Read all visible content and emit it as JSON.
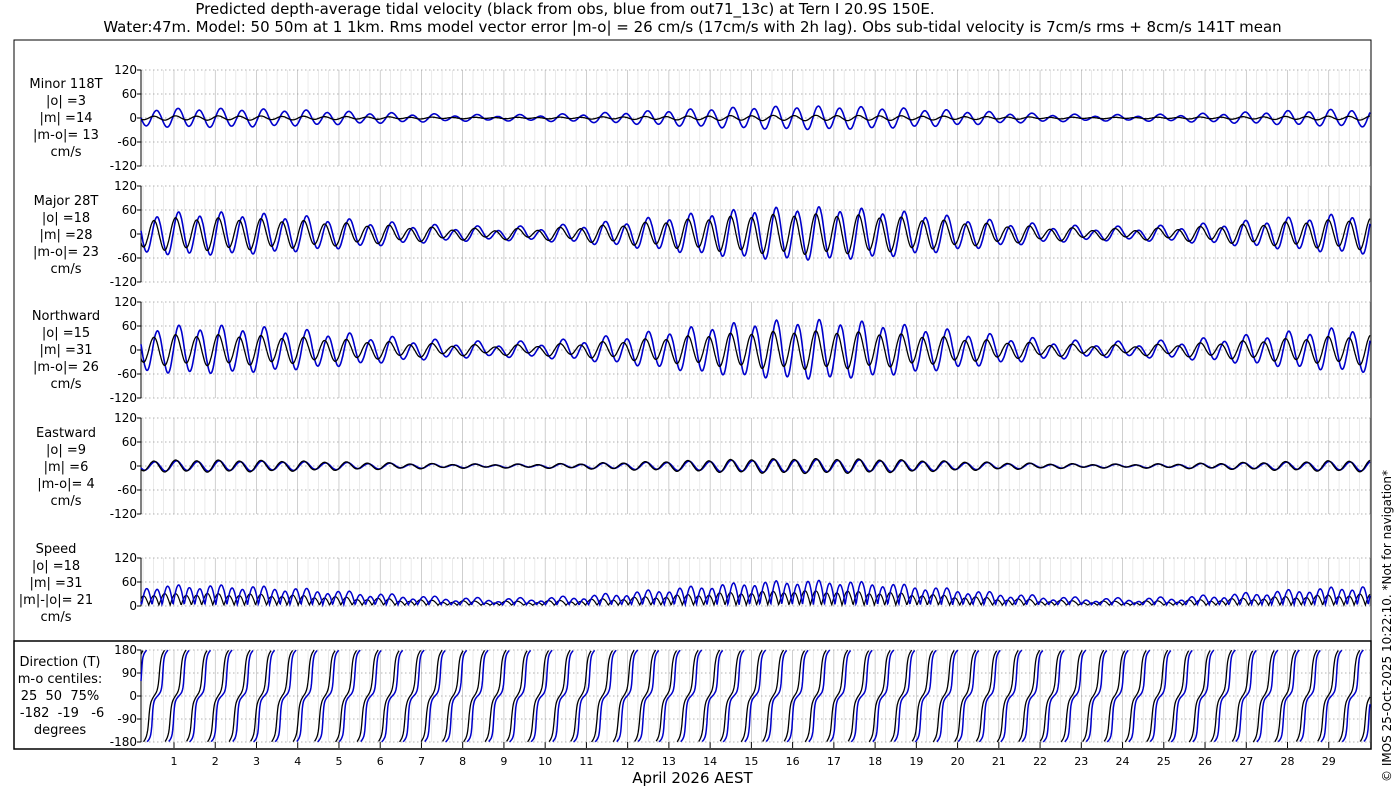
{
  "title_line1": "Predicted depth-average tidal velocity (black from obs, blue from out71_13c) at Tern I 20.9S 150E.",
  "title_line2": "Water:47m. Model: 50 50m at 1 1km. Rms model vector error |m-o| = 26 cm/s (17cm/s with 2h lag). Obs sub-tidal velocity is 7cm/s rms + 8cm/s 141T mean",
  "xlabel": "April 2026 AEST",
  "credit": "© IMOS 25-Oct-2025 10:22:10. *Not for navigation*",
  "colors": {
    "obs": "#000000",
    "model": "#0000cc",
    "grid": "#9a9a9a",
    "axis": "#000000"
  },
  "chart_data": {
    "type": "line",
    "x_axis": {
      "unit": "day of April 2026",
      "range": [
        0.2,
        30.0
      ],
      "ticks": [
        1,
        2,
        3,
        4,
        5,
        6,
        7,
        8,
        9,
        10,
        11,
        12,
        13,
        14,
        15,
        16,
        17,
        18,
        19,
        20,
        21,
        22,
        23,
        24,
        25,
        26,
        27,
        28,
        29
      ]
    },
    "series_legend": [
      "obs (black)",
      "model (blue)"
    ],
    "panels": [
      {
        "id": "minor",
        "label_lines": [
          "Minor 118T",
          "|o| =3",
          "|m| =14",
          "|m-o|= 13",
          "cm/s"
        ],
        "ylim": [
          -120,
          120
        ],
        "yticks": [
          "120",
          "60",
          "0",
          "-60",
          "-120"
        ],
        "ytick_values": [
          120,
          60,
          0,
          -60,
          -120
        ],
        "kind": "signed",
        "obs_amplitude": 5,
        "model_amplitude": 22,
        "model_phase_hours": 1.5
      },
      {
        "id": "major",
        "label_lines": [
          "Major 28T",
          "|o| =18",
          "|m| =28",
          "|m-o|= 23",
          "cm/s"
        ],
        "ylim": [
          -120,
          120
        ],
        "yticks": [
          "120",
          "60",
          "0",
          "-60",
          "-120"
        ],
        "ytick_values": [
          120,
          60,
          0,
          -60,
          -120
        ],
        "kind": "signed",
        "obs_amplitude": 38,
        "model_amplitude": 50,
        "model_phase_hours": 1.8
      },
      {
        "id": "north",
        "label_lines": [
          "Northward",
          "|o| =15",
          "|m| =31",
          "|m-o|= 26",
          "cm/s"
        ],
        "ylim": [
          -120,
          120
        ],
        "yticks": [
          "120",
          "60",
          "0",
          "-60",
          "-120"
        ],
        "ytick_values": [
          120,
          60,
          0,
          -60,
          -120
        ],
        "kind": "signed",
        "obs_amplitude": 36,
        "model_amplitude": 56,
        "model_phase_hours": 2.0
      },
      {
        "id": "east",
        "label_lines": [
          "Eastward",
          "|o| =9",
          "|m| =6",
          "|m-o|= 4",
          "cm/s"
        ],
        "ylim": [
          -120,
          120
        ],
        "yticks": [
          "120",
          "60",
          "0",
          "-60",
          "-120"
        ],
        "ytick_values": [
          120,
          60,
          0,
          -60,
          -120
        ],
        "kind": "signed",
        "obs_amplitude": 14,
        "model_amplitude": 12,
        "model_phase_hours": 0.6
      },
      {
        "id": "speed",
        "label_lines": [
          "Speed",
          "|o| =18",
          "|m| =31",
          "|m|-|o|= 21",
          "cm/s"
        ],
        "ylim": [
          0,
          120
        ],
        "yticks": [
          "120",
          "60",
          "0"
        ],
        "ytick_values": [
          120,
          60,
          0
        ],
        "kind": "speed",
        "obs_amplitude": 30,
        "model_amplitude": 50,
        "model_phase_hours": 1.8
      },
      {
        "id": "direction",
        "label_lines": [
          "Direction (T)",
          "m-o centiles:",
          "25  50  75%",
          " -182  -19   -6",
          "degrees"
        ],
        "ylim": [
          -180,
          180
        ],
        "yticks": [
          "180",
          "90",
          "0",
          "-90",
          "-180"
        ],
        "ytick_values": [
          180,
          90,
          0,
          -90,
          -180
        ],
        "kind": "direction",
        "model_phase_hours": 2.0
      }
    ],
    "tidal_pattern": {
      "semidiurnal_period_hours": 12.42,
      "spring_neap_period_days": 14.77,
      "neap_days": [
        9.0,
        23.8
      ],
      "spring_days": [
        1.6,
        16.6
      ]
    }
  }
}
